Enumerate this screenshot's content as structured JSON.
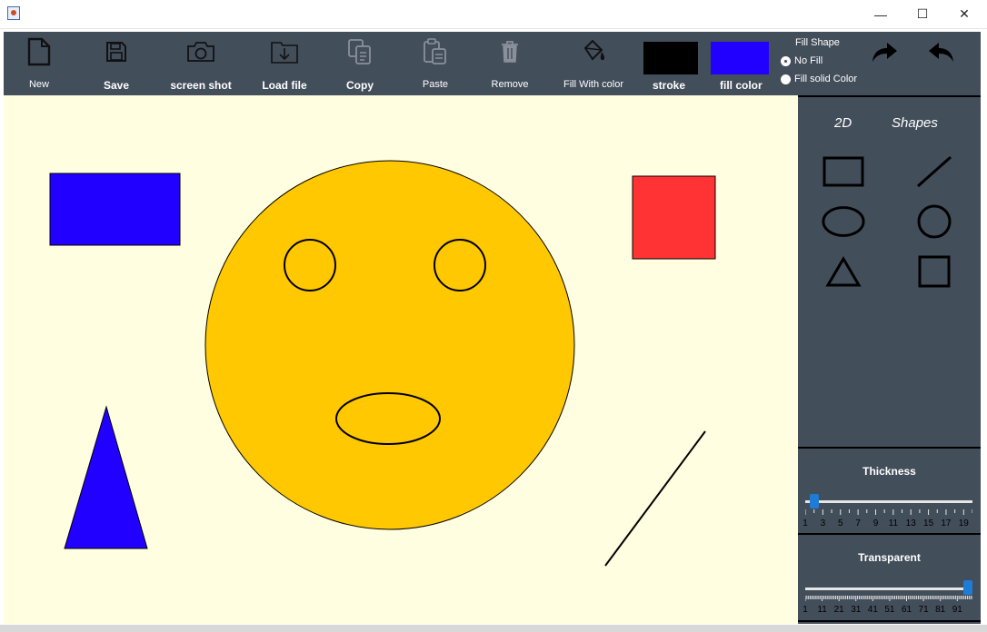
{
  "window": {
    "minimize": "—",
    "maximize": "☐",
    "close": "✕"
  },
  "toolbar": {
    "new": "New",
    "save": "Save",
    "screenshot": "screen shot",
    "load": "Load file",
    "copy": "Copy",
    "paste": "Paste",
    "remove": "Remove",
    "fill_with_color": "Fill With color",
    "stroke": "stroke",
    "fill_color": "fill color",
    "stroke_color": "#000000",
    "fill_color_value": "#2200ff"
  },
  "fill_shape": {
    "title": "Fill Shape",
    "options": [
      "No Fill",
      "Fill solid Color"
    ],
    "selected": "No Fill"
  },
  "sidebar": {
    "title_2d": "2D",
    "title_shapes": "Shapes",
    "shape_tools": [
      "rectangle-tool",
      "line-tool",
      "ellipse-tool",
      "circle-tool",
      "triangle-tool",
      "square-tool"
    ]
  },
  "thickness": {
    "title": "Thickness",
    "labels": [
      "1",
      "3",
      "5",
      "7",
      "9",
      "11",
      "13",
      "15",
      "17",
      "19"
    ],
    "min": 1,
    "max": 20,
    "value": 2
  },
  "transparent": {
    "title": "Transparent",
    "labels": [
      "1",
      "11",
      "21",
      "31",
      "41",
      "51",
      "61",
      "71",
      "81",
      "91"
    ],
    "min": 1,
    "max": 100,
    "value": 100
  },
  "canvas_shapes": {
    "background": "#fffee0",
    "blue_rectangle_color": "#2200ff",
    "red_square_color": "#ff3333",
    "face_color": "#ffc800",
    "triangle_color": "#2200ff"
  }
}
